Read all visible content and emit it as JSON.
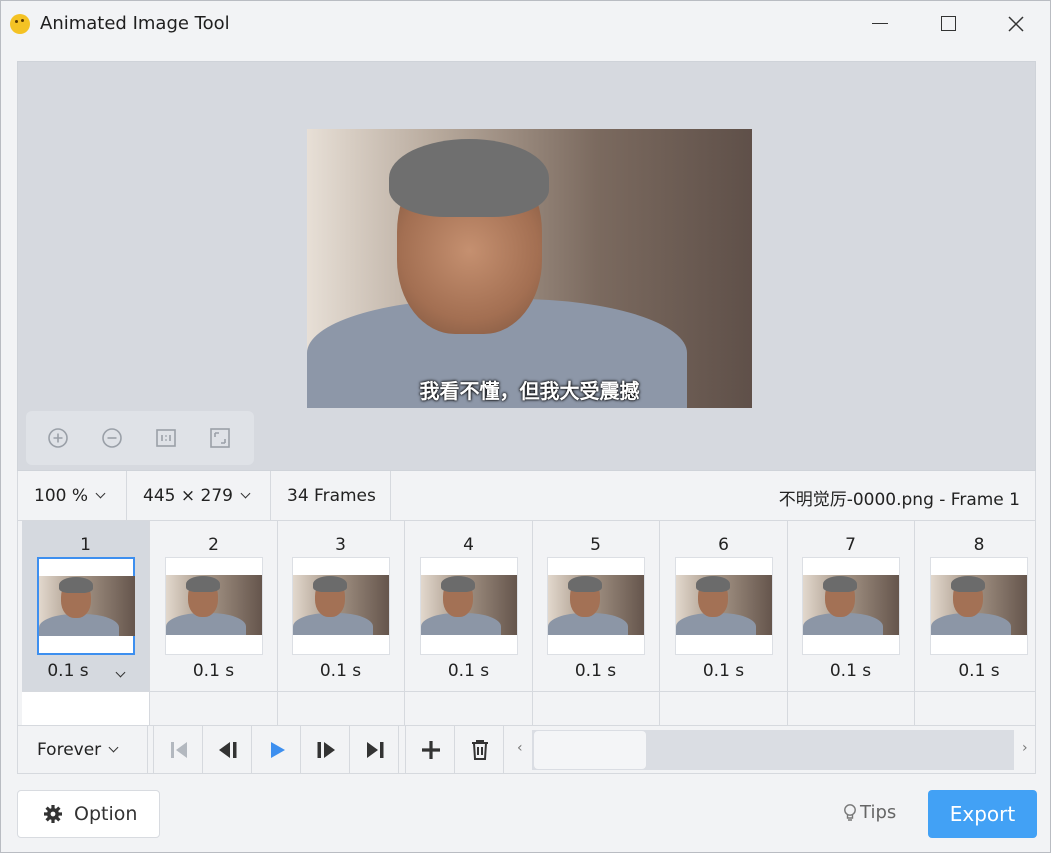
{
  "window": {
    "title": "Animated Image Tool",
    "icon": "emoji-face-icon"
  },
  "preview": {
    "subtitle_text": "我看不懂，但我大受震撼",
    "zoom_controls": [
      "zoom-in-icon",
      "zoom-out-icon",
      "actual-size-icon",
      "fit-to-window-icon"
    ]
  },
  "infobar": {
    "zoom": "100 %",
    "dimensions": "445 × 279",
    "frame_count": "34 Frames",
    "file_info": "不明觉厉-0000.png - Frame 1"
  },
  "frames": [
    {
      "number": "1",
      "delay": "0.1 s",
      "selected": true
    },
    {
      "number": "2",
      "delay": "0.1 s"
    },
    {
      "number": "3",
      "delay": "0.1 s"
    },
    {
      "number": "4",
      "delay": "0.1 s"
    },
    {
      "number": "5",
      "delay": "0.1 s"
    },
    {
      "number": "6",
      "delay": "0.1 s"
    },
    {
      "number": "7",
      "delay": "0.1 s"
    },
    {
      "number": "8",
      "delay": "0.1 s"
    }
  ],
  "toolbar": {
    "loop": "Forever",
    "buttons": [
      "first-frame-icon",
      "previous-frame-icon",
      "play-icon",
      "next-frame-icon",
      "last-frame-icon",
      "add-icon",
      "delete-icon"
    ]
  },
  "footer": {
    "option_label": "Option",
    "tips_label": "Tips",
    "export_label": "Export"
  },
  "colors": {
    "accent": "#42a1f5",
    "play": "#3d8fef",
    "selection_border": "#3d8fef"
  }
}
